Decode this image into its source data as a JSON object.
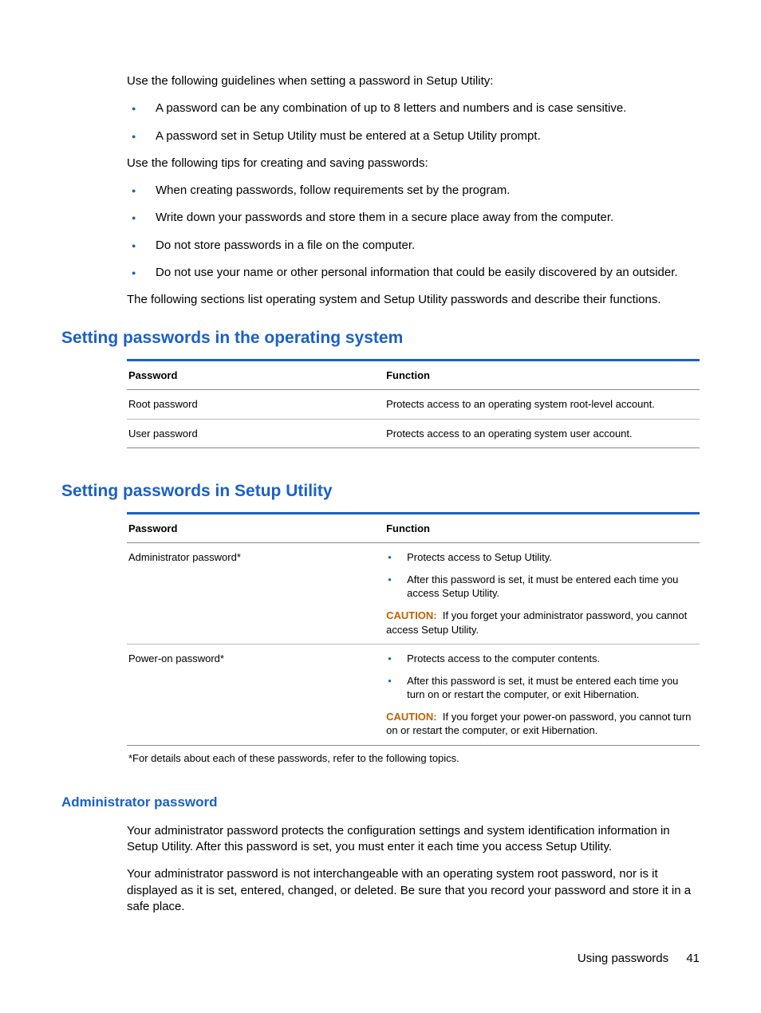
{
  "intro": {
    "p1": "Use the following guidelines when setting a password in Setup Utility:",
    "list1": [
      "A password can be any combination of up to 8 letters and numbers and is case sensitive.",
      "A password set in Setup Utility must be entered at a Setup Utility prompt."
    ],
    "p2": "Use the following tips for creating and saving passwords:",
    "list2": [
      "When creating passwords, follow requirements set by the program.",
      "Write down your passwords and store them in a secure place away from the computer.",
      "Do not store passwords in a file on the computer.",
      "Do not use your name or other personal information that could be easily discovered by an outsider."
    ],
    "p3": "The following sections list operating system and Setup Utility passwords and describe their functions."
  },
  "os_section": {
    "heading": "Setting passwords in the operating system",
    "th1": "Password",
    "th2": "Function",
    "rows": [
      {
        "password": "Root password",
        "function": "Protects access to an operating system root-level account."
      },
      {
        "password": "User password",
        "function": "Protects access to an operating system user account."
      }
    ]
  },
  "su_section": {
    "heading": "Setting passwords in Setup Utility",
    "th1": "Password",
    "th2": "Function",
    "caution_label": "CAUTION:",
    "rows": [
      {
        "password": "Administrator password*",
        "bullets": [
          "Protects access to Setup Utility.",
          "After this password is set, it must be entered each time you access Setup Utility."
        ],
        "caution": "If you forget your administrator password, you cannot access Setup Utility."
      },
      {
        "password": "Power-on password*",
        "bullets": [
          "Protects access to the computer contents.",
          "After this password is set, it must be entered each time you turn on or restart the computer, or exit Hibernation."
        ],
        "caution": "If you forget your power-on password, you cannot turn on or restart the computer, or exit Hibernation."
      }
    ],
    "footnote": "*For details about each of these passwords, refer to the following topics."
  },
  "admin_section": {
    "heading": "Administrator password",
    "p1": "Your administrator password protects the configuration settings and system identification information in Setup Utility. After this password is set, you must enter it each time you access Setup Utility.",
    "p2": "Your administrator password is not interchangeable with an operating system root password, nor is it displayed as it is set, entered, changed, or deleted. Be sure that you record your password and store it in a safe place."
  },
  "footer": {
    "title": "Using passwords",
    "page": "41"
  }
}
